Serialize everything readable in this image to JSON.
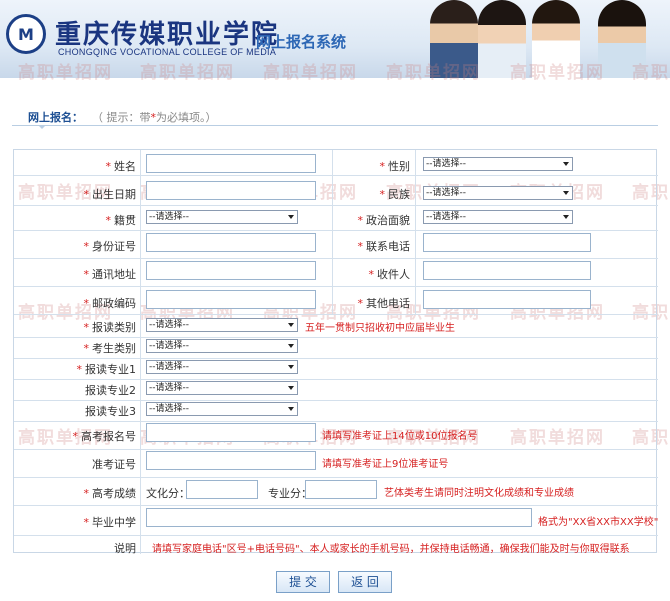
{
  "header": {
    "logo_letter": "M",
    "college_name_cn": "重庆传媒职业学院",
    "college_name_en": "CHONGQING VOCATIONAL COLLEGE OF MEDIA",
    "system_title": "网上报名系统"
  },
  "watermark_text": "高职单招网",
  "subbar": {
    "title": "网上报名：",
    "tip_open": "（ 提示：带",
    "tip_star": "*",
    "tip_close": "为必填项。）"
  },
  "select_placeholder": "--请选择--",
  "fields": {
    "name": "姓名",
    "gender": "性别",
    "birthdate": "出生日期",
    "ethnicity": "民族",
    "native_place": "籍贯",
    "political_status": "政治面貌",
    "id_number": "身份证号",
    "phone": "联系电话",
    "address": "通讯地址",
    "recipient": "收件人",
    "postcode": "邮政编码",
    "other_phone": "其他电话",
    "apply_category": "报读类别",
    "student_category": "考生类别",
    "major1": "报读专业1",
    "major2": "报读专业2",
    "major3": "报读专业3",
    "exam_reg_no": "高考报名号",
    "admission_ticket": "准考证号",
    "exam_score": "高考成绩",
    "culture_score": "文化分：",
    "major_score": "专业分：",
    "graduate_school": "毕业中学",
    "note": "说明"
  },
  "star": "*",
  "hints": {
    "apply_category": "五年一贯制只招收初中应届毕业生",
    "exam_reg_no": "请填写准考证上14位或10位报名号",
    "admission_ticket": "请填写准考证上9位准考证号",
    "exam_score": "艺体类考生请同时注明文化成绩和专业成绩",
    "graduate_school": "格式为\"XX省XX市XX学校\"",
    "note": "请填写家庭电话\"区号+电话号码\"、本人或家长的手机号码，并保持电话畅通，确保我们能及时与你取得联系"
  },
  "buttons": {
    "submit": "提 交",
    "back": "返 回"
  },
  "colors": {
    "brand_blue": "#1a3580",
    "required_red": "#d62020",
    "border": "#c9d7e6"
  }
}
